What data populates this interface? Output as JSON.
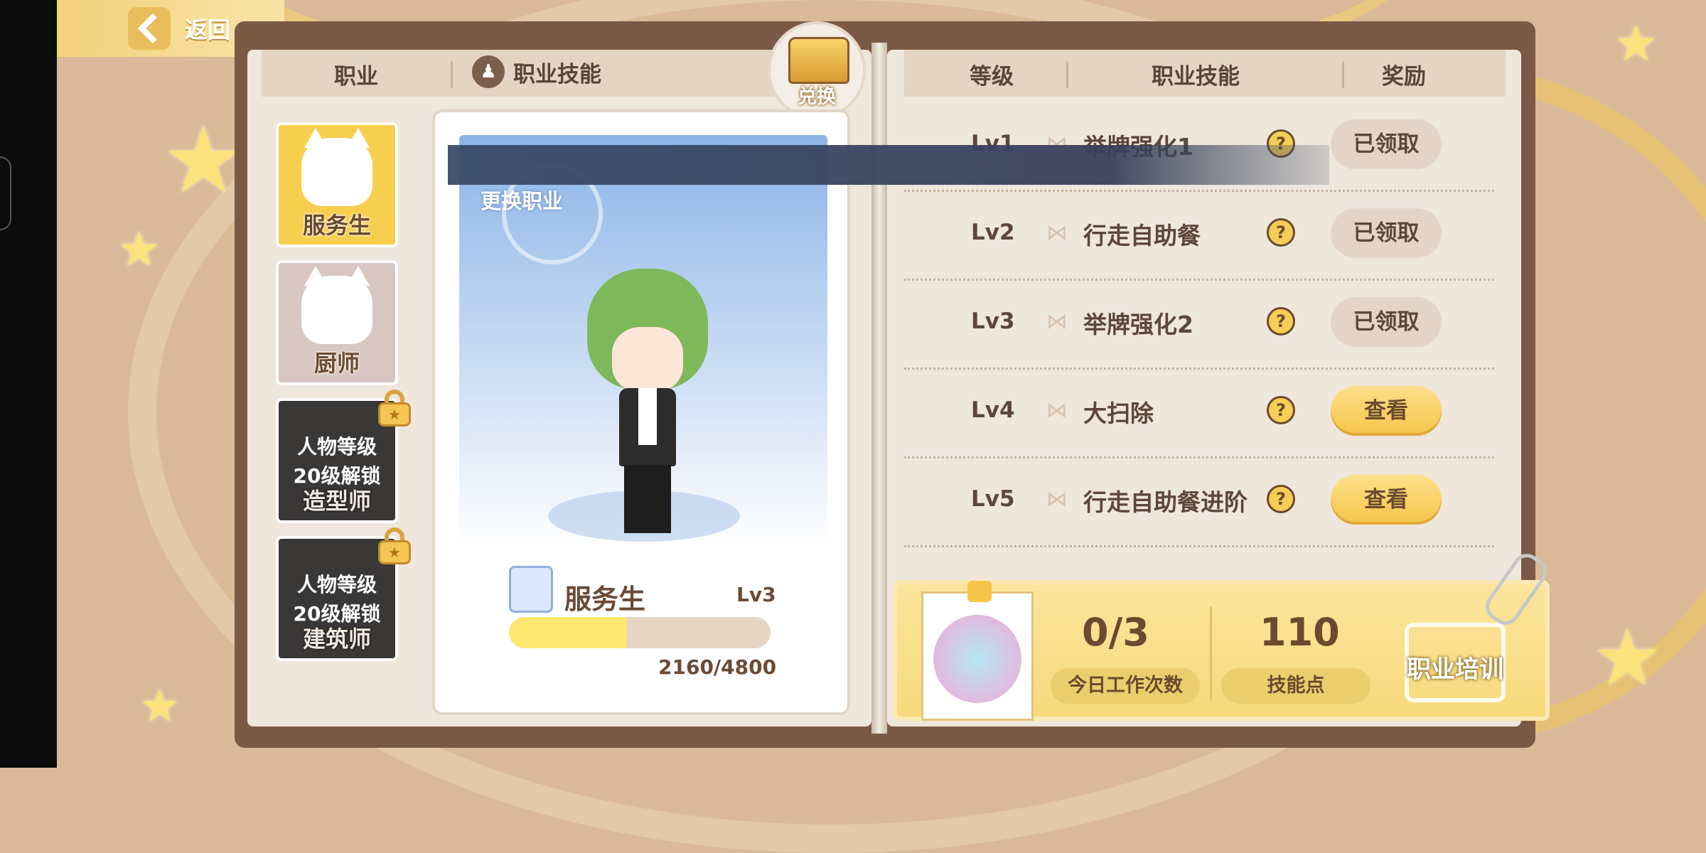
{
  "nav": {
    "back_label": "返回"
  },
  "left_page": {
    "tab_job": "职业",
    "tab_skill": "职业技能",
    "exchange_label": "兑换",
    "jobs": [
      {
        "name": "服务生",
        "state": "active"
      },
      {
        "name": "厨师",
        "state": "unlocked"
      },
      {
        "name": "造型师",
        "state": "locked",
        "lock_line1": "人物等级",
        "lock_line2": "20级解锁"
      },
      {
        "name": "建筑师",
        "state": "locked",
        "lock_line1": "人物等级",
        "lock_line2": "20级解锁"
      }
    ],
    "character": {
      "change_job_label": "更换职业",
      "job_name": "服务生",
      "job_level": "Lv3",
      "xp_text": "2160/4800",
      "xp_progress": 0.45
    }
  },
  "right_page": {
    "col_level": "等级",
    "col_skill": "职业技能",
    "col_reward": "奖励",
    "skills": [
      {
        "level": "Lv1",
        "name": "举牌强化1",
        "reward": "已领取",
        "reward_state": "claimed"
      },
      {
        "level": "Lv2",
        "name": "行走自助餐",
        "reward": "已领取",
        "reward_state": "claimed"
      },
      {
        "level": "Lv3",
        "name": "举牌强化2",
        "reward": "已领取",
        "reward_state": "claimed"
      },
      {
        "level": "Lv4",
        "name": "大扫除",
        "reward": "查看",
        "reward_state": "view"
      },
      {
        "level": "Lv5",
        "name": "行走自助餐进阶",
        "reward": "查看",
        "reward_state": "view"
      }
    ]
  },
  "stats": {
    "work_count_value": "0/3",
    "work_count_label": "今日工作次数",
    "skill_points_value": "110",
    "skill_points_label": "技能点",
    "train_label": "职业培训"
  },
  "colors": {
    "accent_yellow": "#f6c448",
    "page_bg": "#efe6dc",
    "book_cover": "#7a5a46",
    "sky_blue": "#8cb4e8"
  }
}
